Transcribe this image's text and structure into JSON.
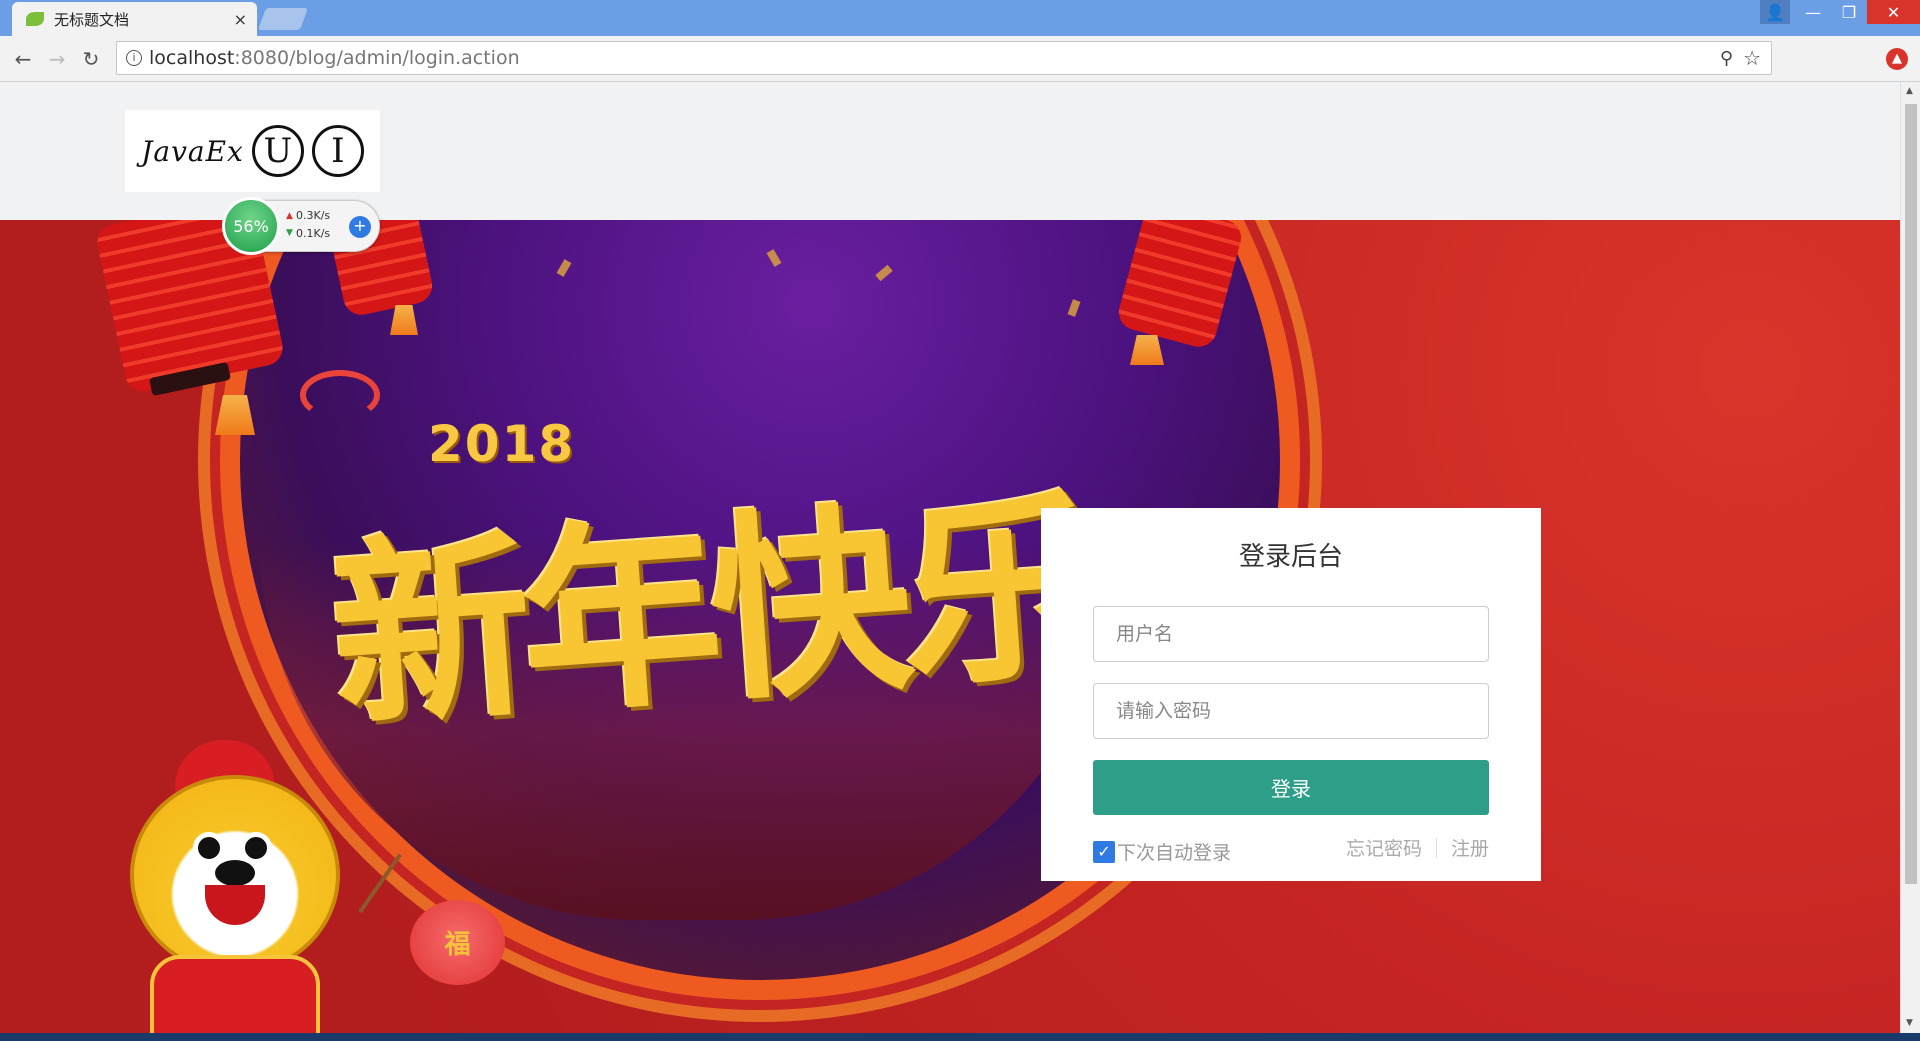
{
  "browser": {
    "tab_title": "无标题文档",
    "tab_close": "×",
    "url_host": "localhost",
    "url_rest": ":8080/blog/admin/login.action",
    "window_controls": {
      "user": "👤",
      "minimize": "—",
      "restore": "❐",
      "close": "✕"
    },
    "nav": {
      "back": "←",
      "forward": "→",
      "reload": "↻"
    },
    "zoom_icon": "⚲",
    "star_icon": "☆",
    "ext_icon": "▲"
  },
  "logo": {
    "text": "JavaEx",
    "circle1": "U",
    "circle2": "I"
  },
  "speed_widget": {
    "percent": "56%",
    "upload": "0.3K/s",
    "download": "0.1K/s",
    "plus": "+"
  },
  "banner": {
    "year": "2018",
    "greeting": "新年快乐",
    "lantern_char": "福"
  },
  "login": {
    "title": "登录后台",
    "username_placeholder": "用户名",
    "password_placeholder": "请输入密码",
    "submit_label": "登录",
    "remember_label": "下次自动登录",
    "remember_checked": true,
    "forgot_label": "忘记密码",
    "register_label": "注册"
  },
  "colors": {
    "accent": "#2f9e88",
    "checkbox": "#2f7be3",
    "titlebar": "#6b9ee4"
  }
}
